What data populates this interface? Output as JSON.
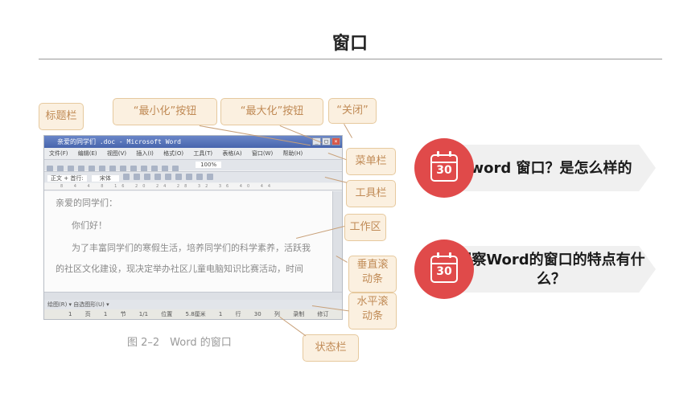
{
  "page": {
    "title": "窗口"
  },
  "figure": {
    "caption": "图 2–2　Word 的窗口",
    "screenshot": {
      "window_title": "亲爱的同学们 .doc - Microsoft Word",
      "menu_items": [
        "文件(F)",
        "编辑(E)",
        "视图(V)",
        "插入(I)",
        "格式(O)",
        "工具(T)",
        "表格(A)",
        "窗口(W)",
        "帮助(H)"
      ],
      "style_value": "正文 + 首行:",
      "font_value": "宋体",
      "zoom_value": "100%",
      "ruler_text": "8 4 4 8 16 20 24 28 32 36 40 44",
      "doc_lines": [
        "亲爱的同学们：",
        "你们好！",
        "为了丰富同学们的寒假生活，培养同学们的科学素养，活跃我",
        "的社区文化建设，现决定举办社区儿童电脑知识比赛活动，时间"
      ],
      "drawbar_text": "绘图(R) ▾  自选图形(U) ▾",
      "status_text": "1 页  1 节  1/1  位置 5.8厘米  1 行  30 列  录制 修订 扩展 改写"
    },
    "callouts": {
      "title_bar": "标题栏",
      "minimize": "“最小化”按钮",
      "maximize": "“最大化”按钮",
      "close": "“关闭”",
      "menu_bar": "菜单栏",
      "tool_bar": "工具栏",
      "work_area": "工作区",
      "vscroll": "垂直滚动条",
      "hscroll": "水平滚动条",
      "status_bar": "状态栏"
    }
  },
  "items": [
    {
      "icon": "calendar-icon",
      "number": "30",
      "text": "word 窗口？是怎么样的"
    },
    {
      "icon": "calendar-icon",
      "number": "30",
      "text": "观察Word的窗口的特点有什么？"
    }
  ],
  "colors": {
    "accent": "#e04a4a",
    "banner": "#f0f0f0",
    "callout_bg": "#fbf0e0",
    "callout_text": "#c08a55"
  }
}
